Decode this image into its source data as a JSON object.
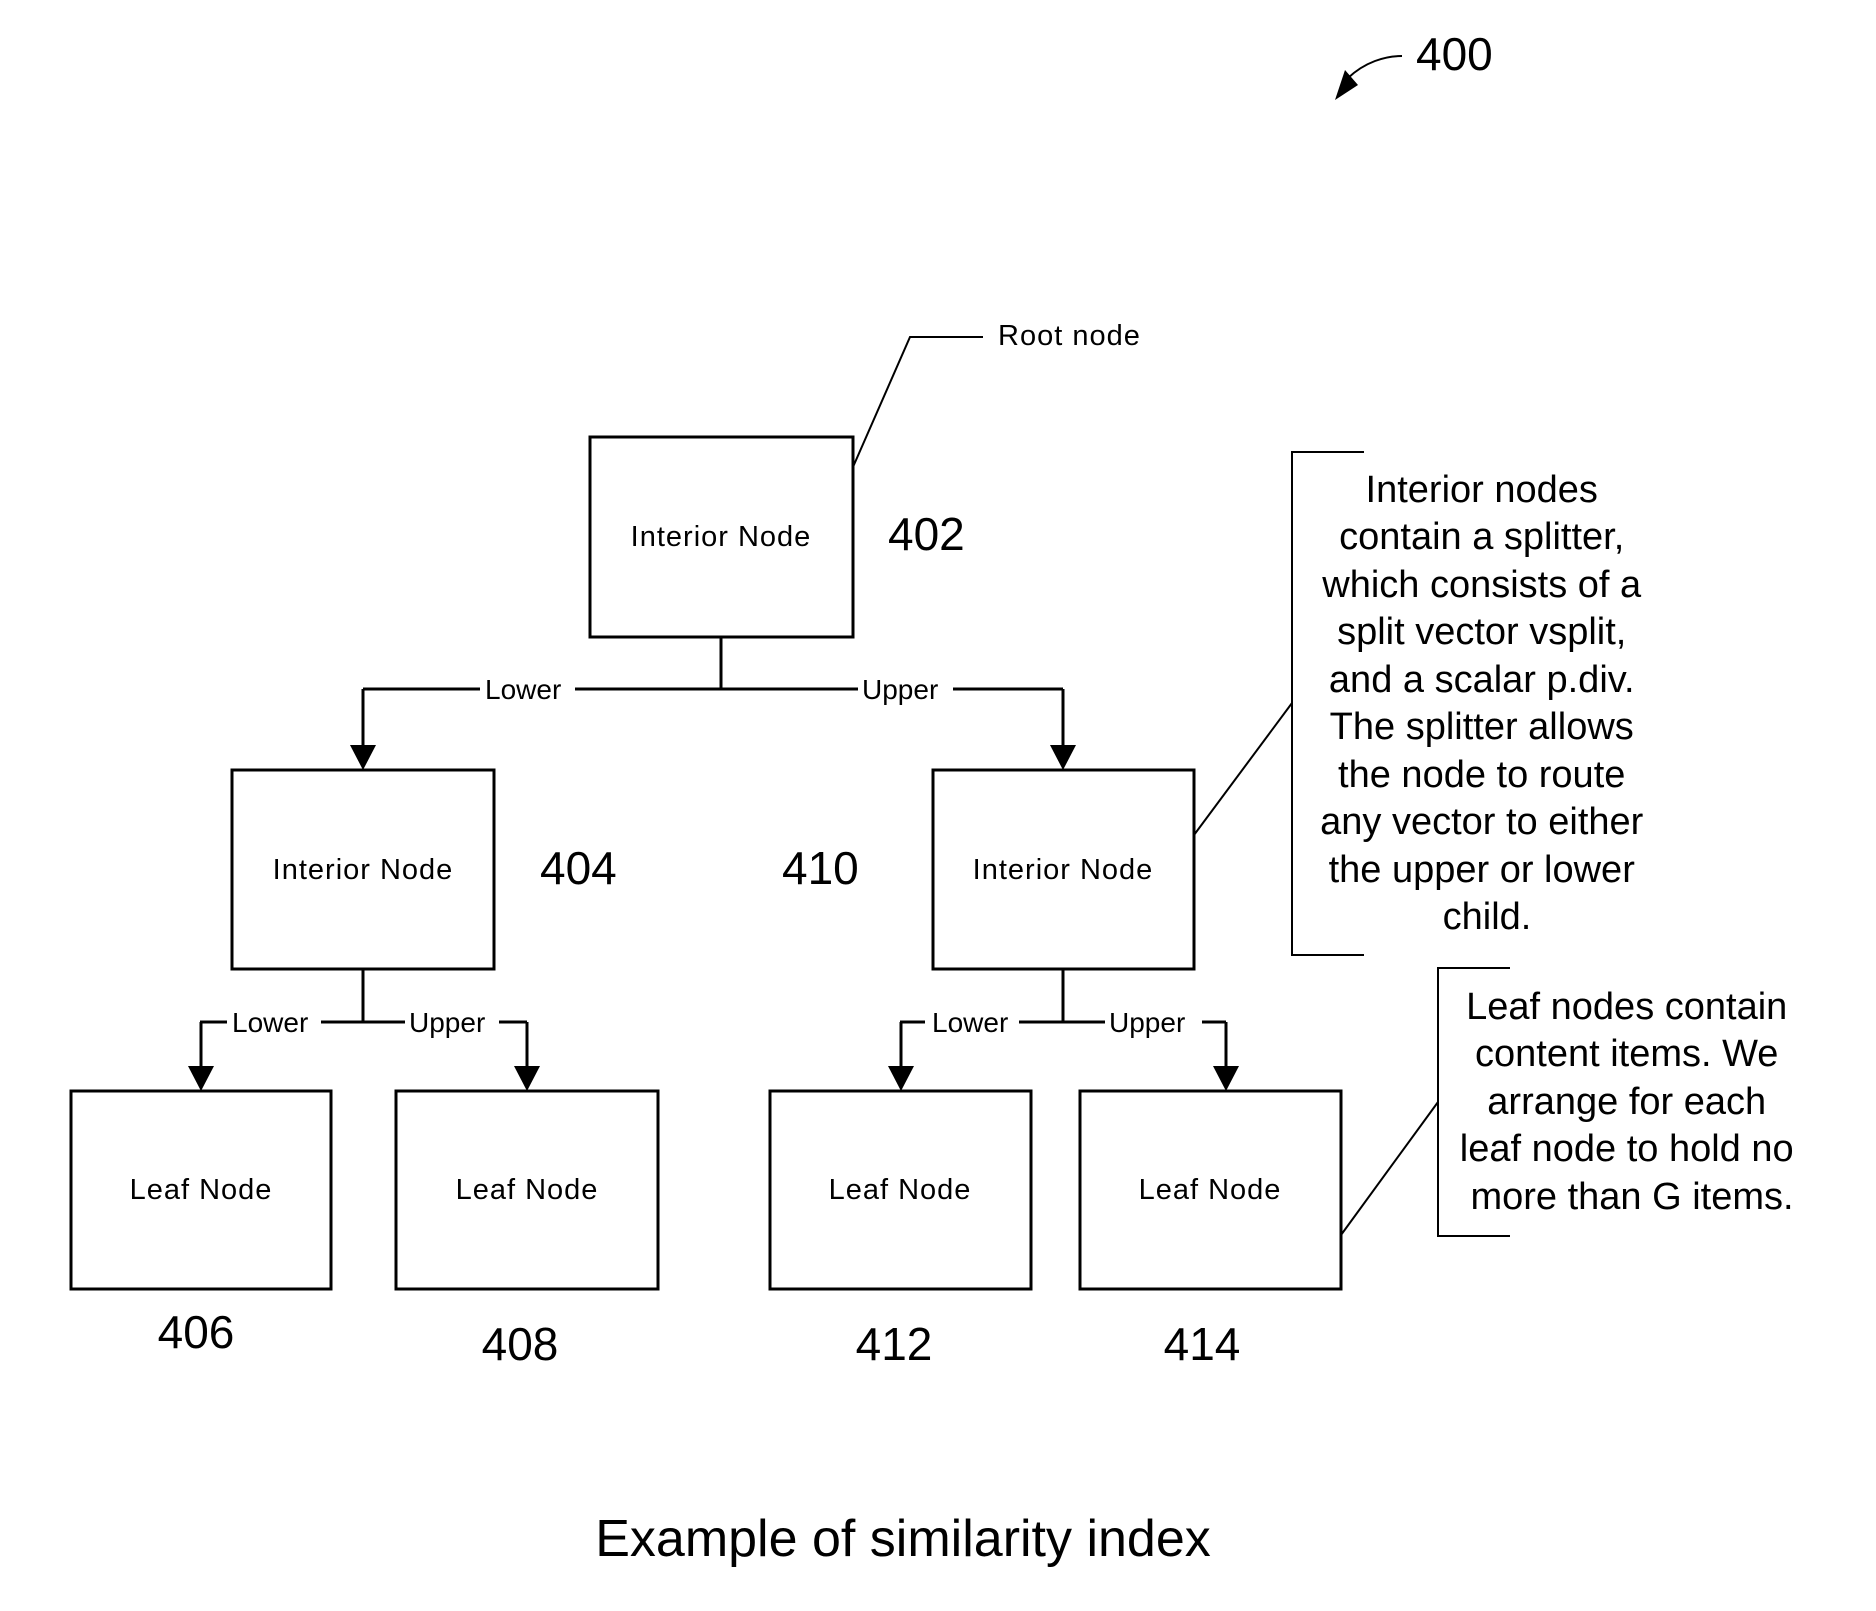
{
  "figure": {
    "number": "400",
    "caption": "Example of similarity index"
  },
  "root_callout": "Root node",
  "nodes": {
    "n402": {
      "label": "Interior Node",
      "ref": "402"
    },
    "n404": {
      "label": "Interior Node",
      "ref": "404"
    },
    "n410": {
      "label": "Interior Node",
      "ref": "410"
    },
    "n406": {
      "label": "Leaf Node",
      "ref": "406"
    },
    "n408": {
      "label": "Leaf Node",
      "ref": "408"
    },
    "n412": {
      "label": "Leaf Node",
      "ref": "412"
    },
    "n414": {
      "label": "Leaf Node",
      "ref": "414"
    }
  },
  "edges": {
    "root_lower": "Lower",
    "root_upper": "Upper",
    "left_lower": "Lower",
    "left_upper": "Upper",
    "right_lower": "Lower",
    "right_upper": "Upper"
  },
  "interior_note": {
    "lines": [
      "Interior nodes",
      "contain a splitter,",
      "which consists of a",
      "split vector vsplit,",
      "and a scalar p.div.",
      "The splitter allows",
      "the node to route",
      "any vector to either",
      "the upper or lower",
      "child."
    ]
  },
  "leaf_note": {
    "lines": [
      "Leaf nodes contain",
      "content items.  We",
      "arrange for each",
      "leaf node to hold no",
      "more than G items."
    ]
  }
}
